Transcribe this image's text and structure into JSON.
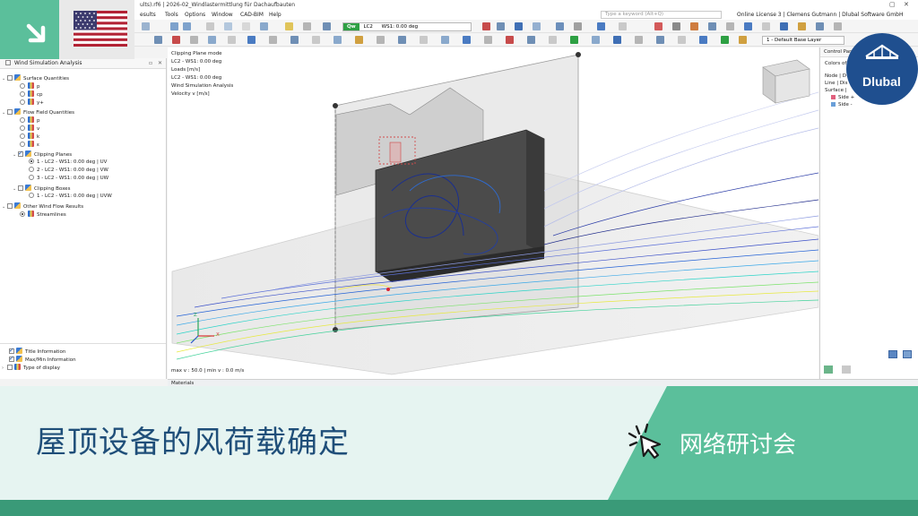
{
  "window": {
    "title_fragment": "ults).rf6 | 2026-02_Windlastermittlung für Dachaufbauten",
    "controls": [
      "▢",
      "✕"
    ]
  },
  "menu": {
    "items": [
      "esults",
      "Tools",
      "Options",
      "Window",
      "CAD-BIM",
      "Help"
    ],
    "search_placeholder": "Type a keyword (Alt+Q)",
    "license": "Online License 3 | Clemens Gutmann | Dlubal Software GmbH"
  },
  "toolbar": {
    "load_badge": "Qw",
    "load_case": "LC2",
    "load_case_desc": "WS1: 0.00 deg",
    "base_layer": "1 - Default Base Layer"
  },
  "navigator": {
    "title": "Wind Simulation Analysis",
    "surface_quantities": "Surface Quantities",
    "surface_items": [
      "p",
      "cp",
      "y+"
    ],
    "flow_field_quantities": "Flow Field Quantities",
    "flow_items": [
      "p",
      "v",
      "k",
      "ε"
    ],
    "clipping_planes": "Clipping Planes",
    "clipping_plane_items": [
      "1 - LC2 - WS1: 0.00 deg | UV",
      "2 - LC2 - WS1: 0.00 deg | VW",
      "3 - LC2 - WS1: 0.00 deg | UW"
    ],
    "clipping_boxes": "Clipping Boxes",
    "clipping_box_items": [
      "1 - LC2 - WS1: 0.00 deg | UVW"
    ],
    "other_results": "Other Wind Flow Results",
    "streamlines": "Streamlines",
    "bottom_items": [
      "Title Information",
      "Max/Min Information",
      "Type of display"
    ]
  },
  "viewport": {
    "info_lines": [
      "Clipping Plane mode",
      "LC2 - WS1: 0.00 deg",
      "Loads [m/s]",
      "LC2 - WS1: 0.00 deg",
      "Wind Simulation Analysis",
      "Velocity v [m/s]"
    ],
    "footer": "max v : 50.0 | min v : 0.0 m/s",
    "axis_x": "X",
    "axis_z": "Z"
  },
  "control_panel": {
    "title": "Control Pan",
    "colors_label": "Colors of",
    "rows": [
      "Node | D",
      "Line | Dis",
      "Surface |"
    ],
    "side_items": [
      {
        "label": "Side +",
        "color": "#e0607e"
      },
      {
        "label": "Side -",
        "color": "#6a9fd8"
      }
    ]
  },
  "materials_label": "Materials",
  "banner": {
    "title": "屋顶设备的风荷载确定",
    "subtitle": "网络研讨会"
  },
  "brand": {
    "logo_text": "Dlubal",
    "accent": "#5bbf9b",
    "navy": "#1f4f8f"
  }
}
